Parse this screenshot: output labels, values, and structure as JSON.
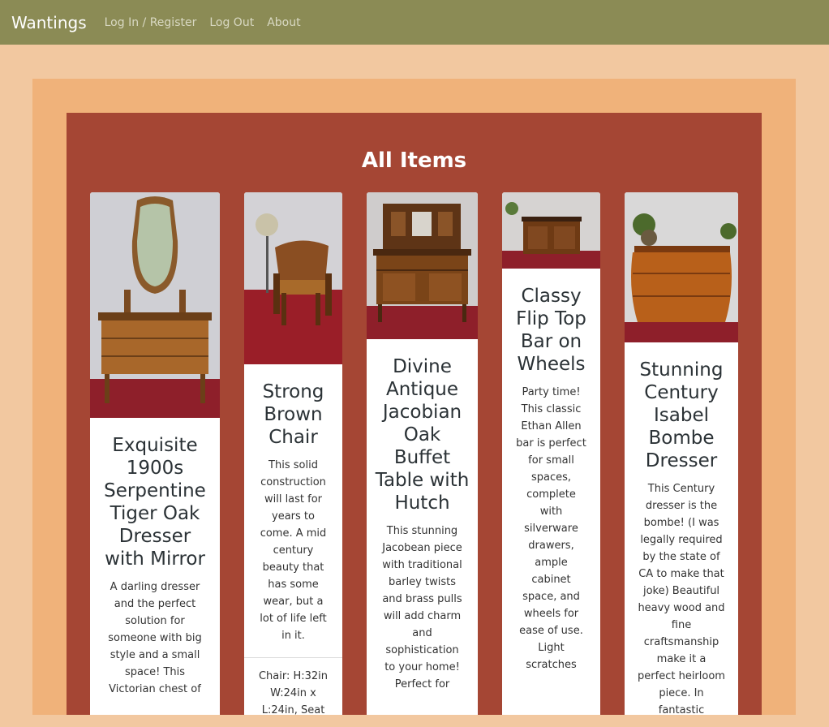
{
  "nav": {
    "brand": "Wantings",
    "links": [
      "Log In / Register",
      "Log Out",
      "About"
    ]
  },
  "page": {
    "title": "All Items"
  },
  "colors": {
    "navbar": "#8b8b55",
    "page_bg": "#f2c8a0",
    "outer_frame": "#f0b27a",
    "inner_frame": "#a54634",
    "card": "#ffffff"
  },
  "items": [
    {
      "title": "Exquisite 1900s Serpentine Tiger Oak Dresser with Mirror",
      "description": "A darling dresser and the perfect solution for someone with big style and a small space! This Victorian chest of"
    },
    {
      "title": "Strong Brown Chair",
      "description": "This solid construction will last for years to come. A mid century beauty that has some wear, but a lot of life left in it.",
      "footer": "Chair: H:32in W:24in x L:24in, Seat"
    },
    {
      "title": "Divine Antique Jacobian Oak Buffet Table with Hutch",
      "description": "This stunning Jacobean piece with traditional barley twists and brass pulls will add charm and sophistication to your home! Perfect for"
    },
    {
      "title": "Classy Flip Top Bar on Wheels",
      "description": "Party time! This classic Ethan Allen bar is perfect for small spaces, complete with silverware drawers, ample cabinet space, and wheels for ease of use. Light scratches"
    },
    {
      "title": "Stunning Century Isabel Bombe Dresser",
      "description": "This Century dresser is the bombe! (I was legally required by the state of CA to make that joke) Beautiful heavy wood and fine craftsmanship make it a perfect heirloom piece. In fantastic"
    }
  ]
}
